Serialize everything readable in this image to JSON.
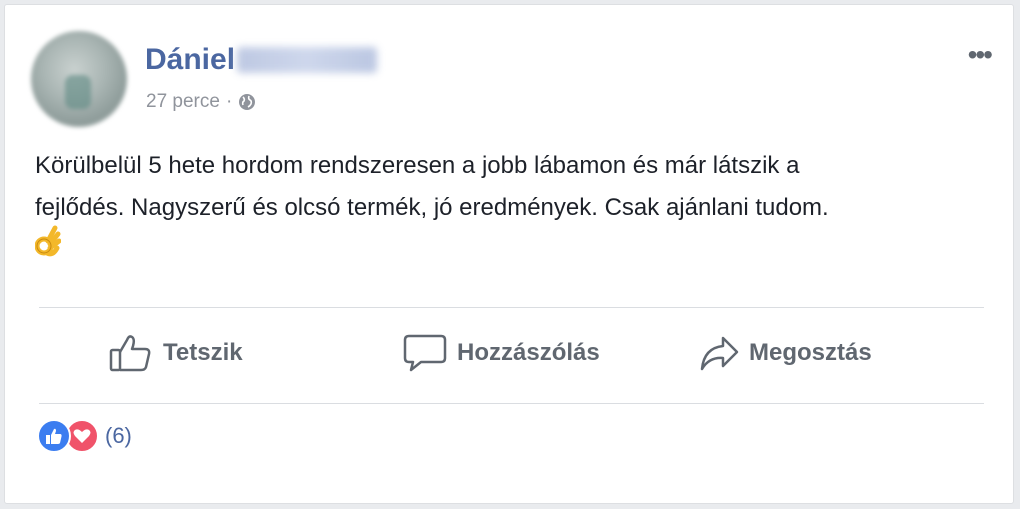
{
  "post": {
    "author_first_name": "Dániel",
    "timestamp": "27 perce",
    "separator": "·",
    "privacy_icon": "globe-icon",
    "text_line1": "Körülbelül 5 hete hordom rendszeresen a jobb lábamon és már látszik a",
    "text_line2": "fejlődés. Nagyszerű és olcsó termék, jó eredmények. Csak ajánlani tudom.",
    "emoji": "ok-hand-emoji"
  },
  "actions": {
    "like_label": "Tetszik",
    "comment_label": "Hozzászólás",
    "share_label": "Megosztás"
  },
  "reactions": {
    "types": [
      "like",
      "love"
    ],
    "count_label": "(6)"
  },
  "colors": {
    "author": "#4b67a1",
    "meta": "#90949c",
    "text": "#1d2129",
    "action": "#606770",
    "like": "#3b7df0",
    "love": "#f0536a"
  }
}
